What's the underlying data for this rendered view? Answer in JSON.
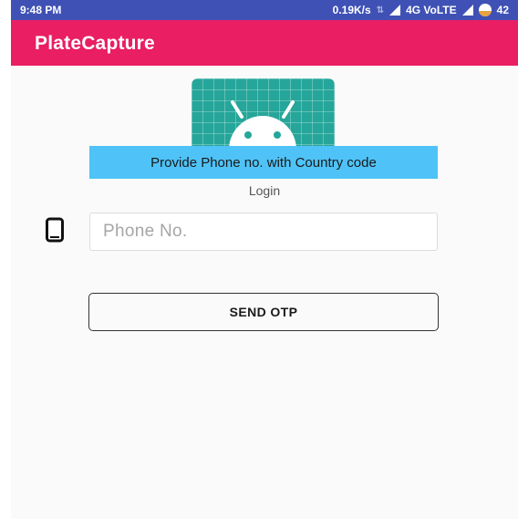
{
  "status_bar": {
    "time": "9:48 PM",
    "network_speed": "0.19K/s",
    "network_type": "4G VoLTE",
    "battery": "42"
  },
  "app_bar": {
    "title": "PlateCapture"
  },
  "toast": {
    "text": "Provide Phone no. with Country code"
  },
  "login": {
    "label": "Login",
    "phone_placeholder": "Phone No.",
    "phone_value": "",
    "send_button": "SEND OTP"
  },
  "icons": {
    "logo": "android-logo-icon",
    "phone": "smartphone-icon"
  },
  "colors": {
    "status_bar": "#3f51b5",
    "app_bar": "#e91e63",
    "logo_bg": "#26a69a",
    "toast_bg": "#4fc3f7"
  }
}
